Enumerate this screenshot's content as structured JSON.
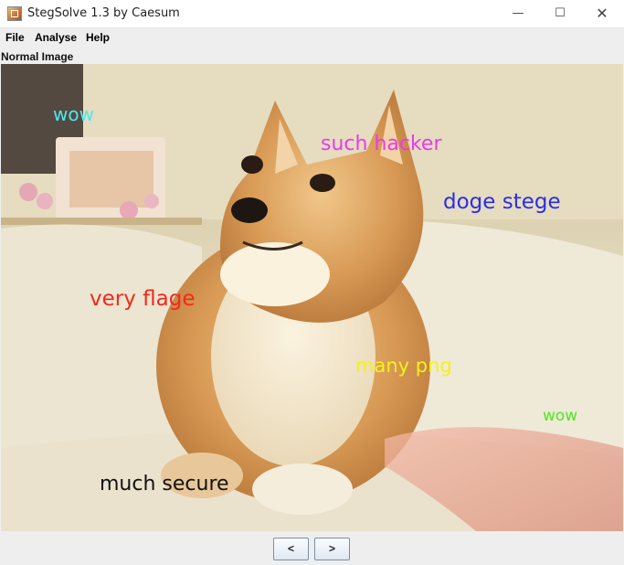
{
  "window": {
    "title": "StegSolve 1.3 by Caesum",
    "minimize_glyph": "—",
    "maximize_glyph": "☐",
    "close_glyph": "✕"
  },
  "menu": {
    "items": [
      {
        "label": "File"
      },
      {
        "label": "Analyse"
      },
      {
        "label": "Help"
      }
    ]
  },
  "panel": {
    "label": "Normal Image"
  },
  "image": {
    "texts": [
      {
        "text": "wow",
        "color": "#4de8f0"
      },
      {
        "text": "such hacker",
        "color": "#e83ce8"
      },
      {
        "text": "doge stege",
        "color": "#2a2ee0"
      },
      {
        "text": "very flage",
        "color": "#f02a1a"
      },
      {
        "text": "many png",
        "color": "#f2f21a"
      },
      {
        "text": "wow",
        "color": "#4ee81e"
      },
      {
        "text": "much secure",
        "color": "#111111"
      }
    ]
  },
  "nav": {
    "prev_label": "<",
    "next_label": ">"
  }
}
